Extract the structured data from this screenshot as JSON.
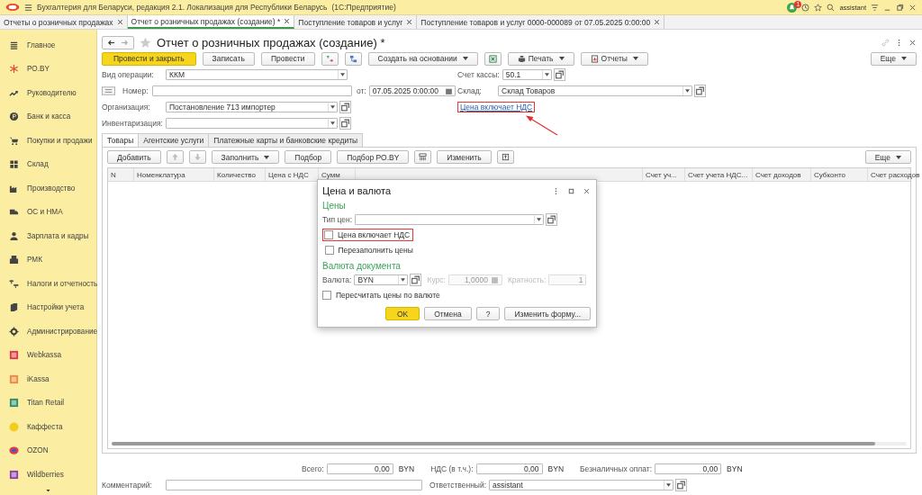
{
  "app_bar": {
    "title": "Бухгалтерия для Беларуси, редакция 2.1. Локализация для Республики Беларусь",
    "mode": "(1С:Предприятие)",
    "notification_count": "1",
    "user": "assistant"
  },
  "open_tabs": [
    {
      "label": "Отчеты о розничных продажах",
      "selected": false
    },
    {
      "label": "Отчет о розничных продажах (создание) *",
      "selected": true
    },
    {
      "label": "Поступление товаров и услуг",
      "selected": false
    },
    {
      "label": "Поступление товаров и услуг 0000-000089 от 07.05.2025 0:00:00",
      "selected": false
    }
  ],
  "sidebar": {
    "items": [
      "Главное",
      "РО.BY",
      "Руководителю",
      "Банк и касса",
      "Покупки и продажи",
      "Склад",
      "Производство",
      "ОС и НМА",
      "Зарплата и кадры",
      "РМК",
      "Налоги и отчетность",
      "Настройки учета",
      "Администрирование",
      "Webkassa",
      "iKassa",
      "Titan Retail",
      "Каффеста",
      "OZON",
      "Wildberries"
    ]
  },
  "form": {
    "title": "Отчет о розничных продажах (создание) *",
    "toolbar": [
      {
        "kind": "primary",
        "label": "Провести и закрыть"
      },
      {
        "kind": "button",
        "label": "Записать"
      },
      {
        "kind": "button",
        "label": "Провести"
      },
      {
        "kind": "journal"
      },
      {
        "kind": "structure"
      },
      {
        "kind": "menu",
        "label": "Создать на основании"
      },
      {
        "kind": "excel"
      },
      {
        "kind": "print",
        "label": "Печать"
      },
      {
        "kind": "reports",
        "label": "Отчеты"
      }
    ],
    "more": "Еще",
    "operation_type": {
      "label": "Вид операции:",
      "value": "ККМ"
    },
    "number": {
      "label": "Номер:"
    },
    "date": {
      "label": "от:",
      "value": "07.05.2025  0:00:00"
    },
    "organization": {
      "label": "Организация:",
      "value": "Постановление 713 импортер"
    },
    "inventory": {
      "label": "Инвентаризация:"
    },
    "cash_account": {
      "label": "Счет кассы:",
      "value": "50.1"
    },
    "warehouse": {
      "label": "Склад:",
      "value": "Склад Товаров"
    },
    "price_link": {
      "label": "Цена включает НДС",
      "annotated": true
    },
    "tabs": [
      {
        "label": "Товары",
        "selected": true
      },
      {
        "label": "Агентские услуги",
        "selected": false
      },
      {
        "label": "Платежные карты и банковские кредиты",
        "selected": false
      }
    ],
    "table_toolbar": [
      {
        "kind": "button",
        "label": "Добавить"
      },
      {
        "kind": "up"
      },
      {
        "kind": "down"
      },
      {
        "kind": "menu",
        "label": "Заполнить"
      },
      {
        "kind": "button",
        "label": "Подбор"
      },
      {
        "kind": "button",
        "label": "Подбор РО.BY"
      },
      {
        "kind": "scan"
      },
      {
        "kind": "button",
        "label": "Изменить"
      },
      {
        "kind": "form"
      }
    ],
    "table_more": "Еще",
    "columns_left": [
      "N",
      "Номенклатура",
      "Количество",
      "Цена с НДС",
      "Сумм"
    ],
    "columns_right": [
      "Счет уч...",
      "Счет учета НДС...",
      "Счет доходов",
      "Субконто",
      "Счет расходов"
    ],
    "totals": [
      {
        "label": "Всего:",
        "value": "0,00",
        "currency": "BYN"
      },
      {
        "label": "НДС (в т.ч.):",
        "value": "0,00",
        "currency": "BYN"
      },
      {
        "label": "Безналичных оплат:",
        "value": "0,00",
        "currency": "BYN"
      }
    ],
    "comment": {
      "label": "Комментарий:"
    },
    "responsible": {
      "label": "Ответственный:",
      "value": "assistant"
    }
  },
  "dialog": {
    "title": "Цена и валюта",
    "prices_heading": "Цены",
    "price_type": {
      "label": "Тип цен:"
    },
    "price_checks": [
      {
        "label": "Цена включает НДС",
        "checked": false,
        "annotated": true
      },
      {
        "label": "Перезаполнить цены",
        "checked": false,
        "annotated": false
      }
    ],
    "currency_heading": "Валюта документа",
    "currency": {
      "label": "Валюта:",
      "value": "BYN"
    },
    "rate": {
      "label": "Курс:",
      "value": "1,0000",
      "disabled": true
    },
    "multiplicity": {
      "label": "Кратность:",
      "value": "1",
      "disabled": true
    },
    "recalc": {
      "label": "Пересчитать цены по валюте",
      "checked": false
    },
    "buttons": [
      {
        "kind": "primary",
        "label": "OK"
      },
      {
        "kind": "button",
        "label": "Отмена"
      },
      {
        "kind": "button",
        "label": "?"
      },
      {
        "kind": "button",
        "label": "Изменить форму..."
      }
    ]
  }
}
